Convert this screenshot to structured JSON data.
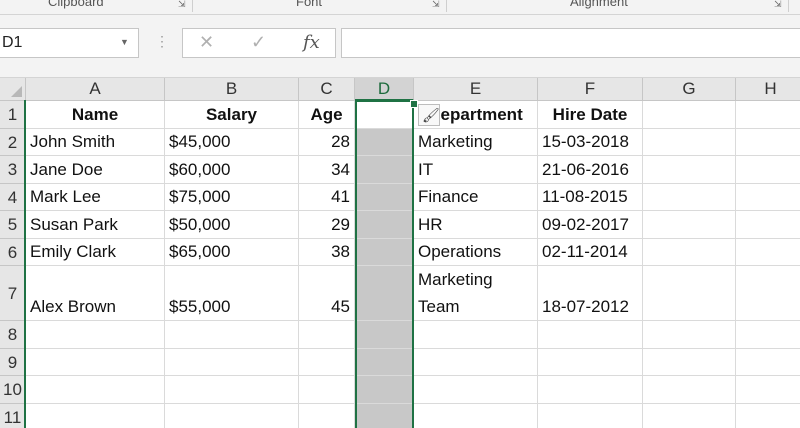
{
  "ribbon": {
    "groups": [
      "Clipboard",
      "Font",
      "Alignment"
    ]
  },
  "formula_bar": {
    "name_box": "D1",
    "cancel_glyph": "✕",
    "enter_glyph": "✓",
    "fx_label": "fx",
    "formula_value": ""
  },
  "sheet": {
    "columns": [
      "A",
      "B",
      "C",
      "D",
      "E",
      "F",
      "G",
      "H"
    ],
    "selected_column": "D",
    "rows": [
      {
        "num": "1",
        "cells": [
          "Name",
          "Salary",
          "Age",
          "",
          "Department",
          "Hire Date",
          "",
          ""
        ]
      },
      {
        "num": "2",
        "cells": [
          "John Smith",
          "$45,000",
          "28",
          "",
          "Marketing",
          "15-03-2018",
          "",
          ""
        ]
      },
      {
        "num": "3",
        "cells": [
          "Jane Doe",
          "$60,000",
          "34",
          "",
          "IT",
          "21-06-2016",
          "",
          ""
        ]
      },
      {
        "num": "4",
        "cells": [
          "Mark Lee",
          "$75,000",
          "41",
          "",
          "Finance",
          "11-08-2015",
          "",
          ""
        ]
      },
      {
        "num": "5",
        "cells": [
          "Susan Park",
          "$50,000",
          "29",
          "",
          "HR",
          "09-02-2017",
          "",
          ""
        ]
      },
      {
        "num": "6",
        "cells": [
          "Emily Clark",
          "$65,000",
          "38",
          "",
          "Operations",
          "02-11-2014",
          "",
          ""
        ]
      },
      {
        "num": "7",
        "cells": [
          "Alex Brown",
          "$55,000",
          "45",
          "",
          "Marketing Team",
          "18-07-2012",
          "",
          ""
        ]
      },
      {
        "num": "8",
        "cells": [
          "",
          "",
          "",
          "",
          "",
          "",
          "",
          ""
        ]
      },
      {
        "num": "9",
        "cells": [
          "",
          "",
          "",
          "",
          "",
          "",
          "",
          ""
        ]
      },
      {
        "num": "10",
        "cells": [
          "",
          "",
          "",
          "",
          "",
          "",
          "",
          ""
        ]
      },
      {
        "num": "11",
        "cells": [
          "",
          "",
          "",
          "",
          "",
          "",
          "",
          ""
        ]
      }
    ]
  },
  "colors": {
    "accent": "#1f7244",
    "selected_fill": "#c8c8c8",
    "header_bg": "#e6e6e6"
  },
  "icons": {
    "paste_options": "paintbrush-icon"
  }
}
